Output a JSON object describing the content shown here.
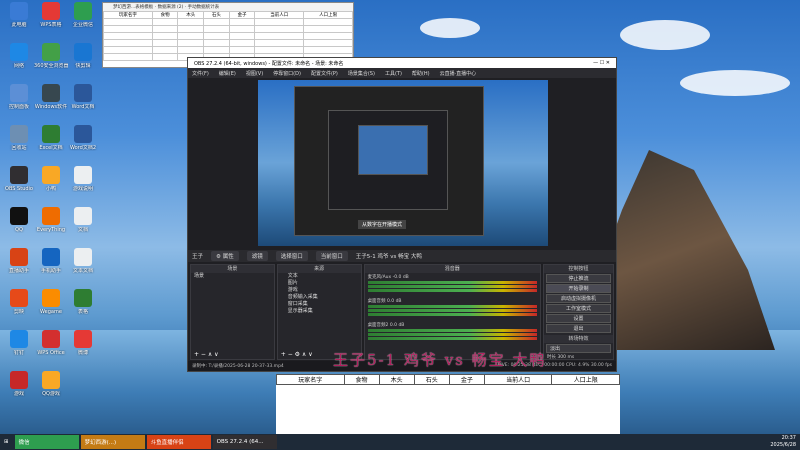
{
  "desktop": {
    "icons": [
      {
        "label": "此电脑",
        "color": "#3a7bd5"
      },
      {
        "label": "WPS表格",
        "color": "#e53935"
      },
      {
        "label": "企业微信",
        "color": "#2e9e4f"
      },
      {
        "label": "网络",
        "color": "#1e88e5"
      },
      {
        "label": "360安全浏览器",
        "color": "#43a047"
      },
      {
        "label": "快剪辑",
        "color": "#1976d2"
      },
      {
        "label": "控制面板",
        "color": "#5c8fd6"
      },
      {
        "label": "Windows软件",
        "color": "#37474f"
      },
      {
        "label": "Word文档",
        "color": "#2b579a"
      },
      {
        "label": "回收站",
        "color": "#6d8fb3"
      },
      {
        "label": "Excel文档",
        "color": "#2e7d32"
      },
      {
        "label": "Word文档2",
        "color": "#2b579a"
      },
      {
        "label": "OBS Studio",
        "color": "#302e31"
      },
      {
        "label": "小鸭",
        "color": "#f9a825"
      },
      {
        "label": "游戏说明",
        "color": "#eceff1"
      },
      {
        "label": "QQ",
        "color": "#111"
      },
      {
        "label": "EveryThing",
        "color": "#ef6c00"
      },
      {
        "label": "文档",
        "color": "#eceff1"
      },
      {
        "label": "直播助手",
        "color": "#d84315"
      },
      {
        "label": "手机助手",
        "color": "#1565c0"
      },
      {
        "label": "文本文档",
        "color": "#eceff1"
      },
      {
        "label": "剪映",
        "color": "#e64a19"
      },
      {
        "label": "Wegame",
        "color": "#fb8c00"
      },
      {
        "label": "表格",
        "color": "#2e7d32"
      },
      {
        "label": "钉钉",
        "color": "#1e88e5"
      },
      {
        "label": "WPS Office",
        "color": "#d32f2f"
      },
      {
        "label": "微博",
        "color": "#e53935"
      },
      {
        "label": "游戏",
        "color": "#c62828"
      },
      {
        "label": "QQ游戏",
        "color": "#f9a825"
      }
    ]
  },
  "excel": {
    "title": "梦幻西游...表格模板 · 数据来源  (2)  ·  手动数据统计表",
    "headers": [
      "玩家名字",
      "食物",
      "木头",
      "石头",
      "金子",
      "当前人口",
      "人口上限"
    ]
  },
  "obs": {
    "title": "OBS 27.2.4 (64-bit, windows) - 配置文件: 未命名 - 场景: 未命名",
    "menu": [
      "文件(F)",
      "编辑(E)",
      "视图(V)",
      "停靠窗口(D)",
      "配置文件(P)",
      "场景集合(S)",
      "工具(T)",
      "帮助(H)",
      "云直播·直播中心"
    ],
    "preview_text": "从数字在开播模式",
    "scene_label": "王子5-1",
    "src_tab": "王子",
    "src_buttons": [
      "⚙ 属性",
      "滤镜",
      "选择窗口",
      "当前窗口"
    ],
    "extra_text": "王子5-1 鸡爷 vs 畅宝 大鸭",
    "docks": {
      "scenes": "场景",
      "sources": "来源",
      "mixer": "混音器",
      "controls": "控制按钮",
      "transitions": "转场特效"
    },
    "scene_items": [
      "场景"
    ],
    "source_items": [
      "文本",
      "图片",
      "游戏",
      "音频输入采集",
      "窗口采集",
      "显示器采集"
    ],
    "mixer_channels": [
      {
        "name": "麦克风/Aux",
        "db": "-0.0 dB"
      },
      {
        "name": "桌面音频",
        "db": "0.0 dB"
      },
      {
        "name": "桌面音频2",
        "db": "0.0 dB"
      }
    ],
    "controls": [
      "停止推流",
      "开始录制",
      "启动虚拟摄像机",
      "工作室模式",
      "设置",
      "退出"
    ],
    "transition": "淡出",
    "duration_label": "时长",
    "duration": "300 ms",
    "status_left": "录制中: T:/录播/2025-06-28 20-37-33.mp4",
    "status_right": "LIVE: 00:25:38  REC: 00:00:00  CPU: 4.9%  30.00 fps"
  },
  "overlay_text": "王子5-1 鸡爷 vs 畅宝 大鸭",
  "bottom_table": {
    "headers": [
      "玩家名字",
      "食物",
      "木头",
      "石头",
      "金子",
      "当前人口",
      "人口上限"
    ]
  },
  "taskbar": {
    "items": [
      "微信",
      "梦幻西游(...)",
      "斗鱼直播伴侣",
      "OBS 27.2.4 (64..."
    ],
    "time": "20:37",
    "date": "2025/6/28"
  }
}
